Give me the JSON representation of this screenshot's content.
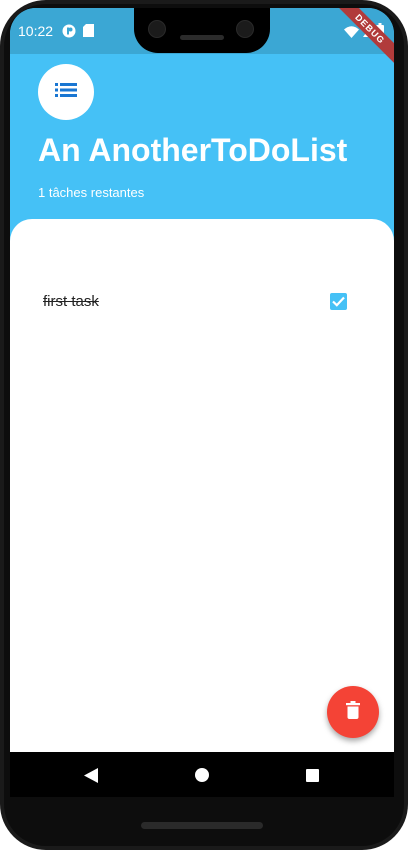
{
  "status_bar": {
    "time": "10:22",
    "icons": [
      "notification-icon",
      "sd-card-icon",
      "wifi-icon",
      "battery-icon"
    ],
    "debug_banner": "DEBUG"
  },
  "header": {
    "logo_icon": "list-icon",
    "title": "An AnotherToDoList",
    "subtitle": "1 tâches restantes"
  },
  "tasks": [
    {
      "label": "first task",
      "completed": true
    }
  ],
  "fab": {
    "icon": "trash-icon"
  },
  "nav": {
    "buttons": [
      "back-icon",
      "home-icon",
      "recents-icon"
    ]
  },
  "colors": {
    "header_bg": "#45c1f6",
    "status_bar_bg": "#3ba7d4",
    "accent": "#45c1f6",
    "fab_bg": "#f44336",
    "logo_icon": "#1976d2"
  }
}
